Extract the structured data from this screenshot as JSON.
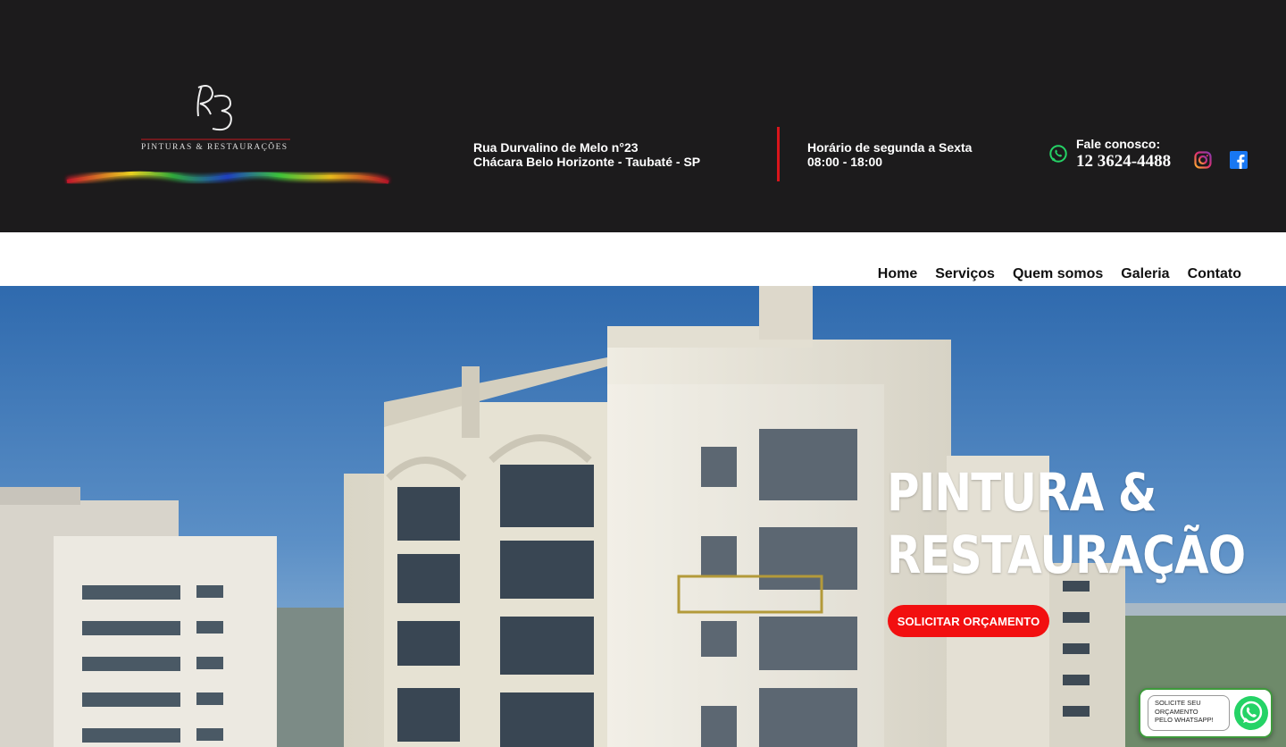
{
  "brand": {
    "logo_monogram": "RB",
    "logo_tagline": "PINTURAS & RESTAURAÇÕES"
  },
  "header": {
    "address_line1": "Rua Durvalino de Melo n°23",
    "address_line2": "Chácara Belo Horizonte - Taubaté - SP",
    "hours_label": "Horário de segunda a Sexta",
    "hours_value": "08:00 - 18:00",
    "contact_label": "Fale conosco:",
    "contact_phone": "12 3624-4488",
    "icons": [
      "whatsapp-icon",
      "instagram-icon",
      "facebook-icon"
    ]
  },
  "nav": {
    "items": [
      {
        "label": "Home"
      },
      {
        "label": "Serviços"
      },
      {
        "label": "Quem somos"
      },
      {
        "label": "Galeria"
      },
      {
        "label": "Contato"
      }
    ]
  },
  "hero": {
    "title_line1": "PINTURA &",
    "title_line2": "RESTAURAÇÃO",
    "cta_label": "SOLICITAR ORÇAMENTO"
  },
  "whatsapp_float": {
    "line1": "SOLICITE SEU",
    "line2": "ORÇAMENTO",
    "line3": "PELO WHATSAPP!"
  },
  "colors": {
    "header_bg": "#1c1b1c",
    "accent_red": "#f20f10",
    "divider_red": "#d8151b",
    "whatsapp_green": "#25d366"
  }
}
